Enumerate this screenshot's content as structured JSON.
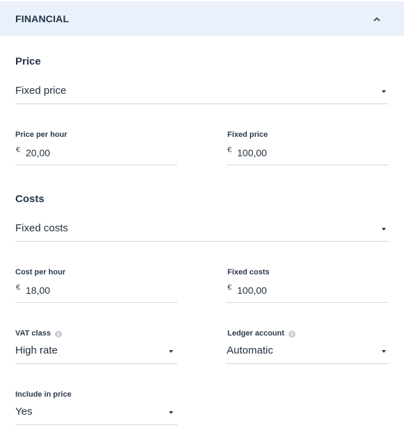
{
  "panel": {
    "title": "FINANCIAL"
  },
  "price": {
    "section_title": "Price",
    "type_selected": "Fixed price",
    "price_per_hour_label": "Price per hour",
    "price_per_hour_currency": "€",
    "price_per_hour_value": "20,00",
    "fixed_price_label": "Fixed price",
    "fixed_price_currency": "€",
    "fixed_price_value": "100,00"
  },
  "costs": {
    "section_title": "Costs",
    "type_selected": "Fixed costs",
    "cost_per_hour_label": "Cost per hour",
    "cost_per_hour_currency": "€",
    "cost_per_hour_value": "18,00",
    "fixed_costs_label": "Fixed costs",
    "fixed_costs_currency": "€",
    "fixed_costs_value": "100,00"
  },
  "vat": {
    "label": "VAT class",
    "selected": "High rate",
    "info_icon": "info-icon"
  },
  "ledger": {
    "label": "Ledger account",
    "selected": "Automatic",
    "info_icon": "info-icon"
  },
  "include": {
    "label": "Include in price",
    "selected": "Yes"
  }
}
